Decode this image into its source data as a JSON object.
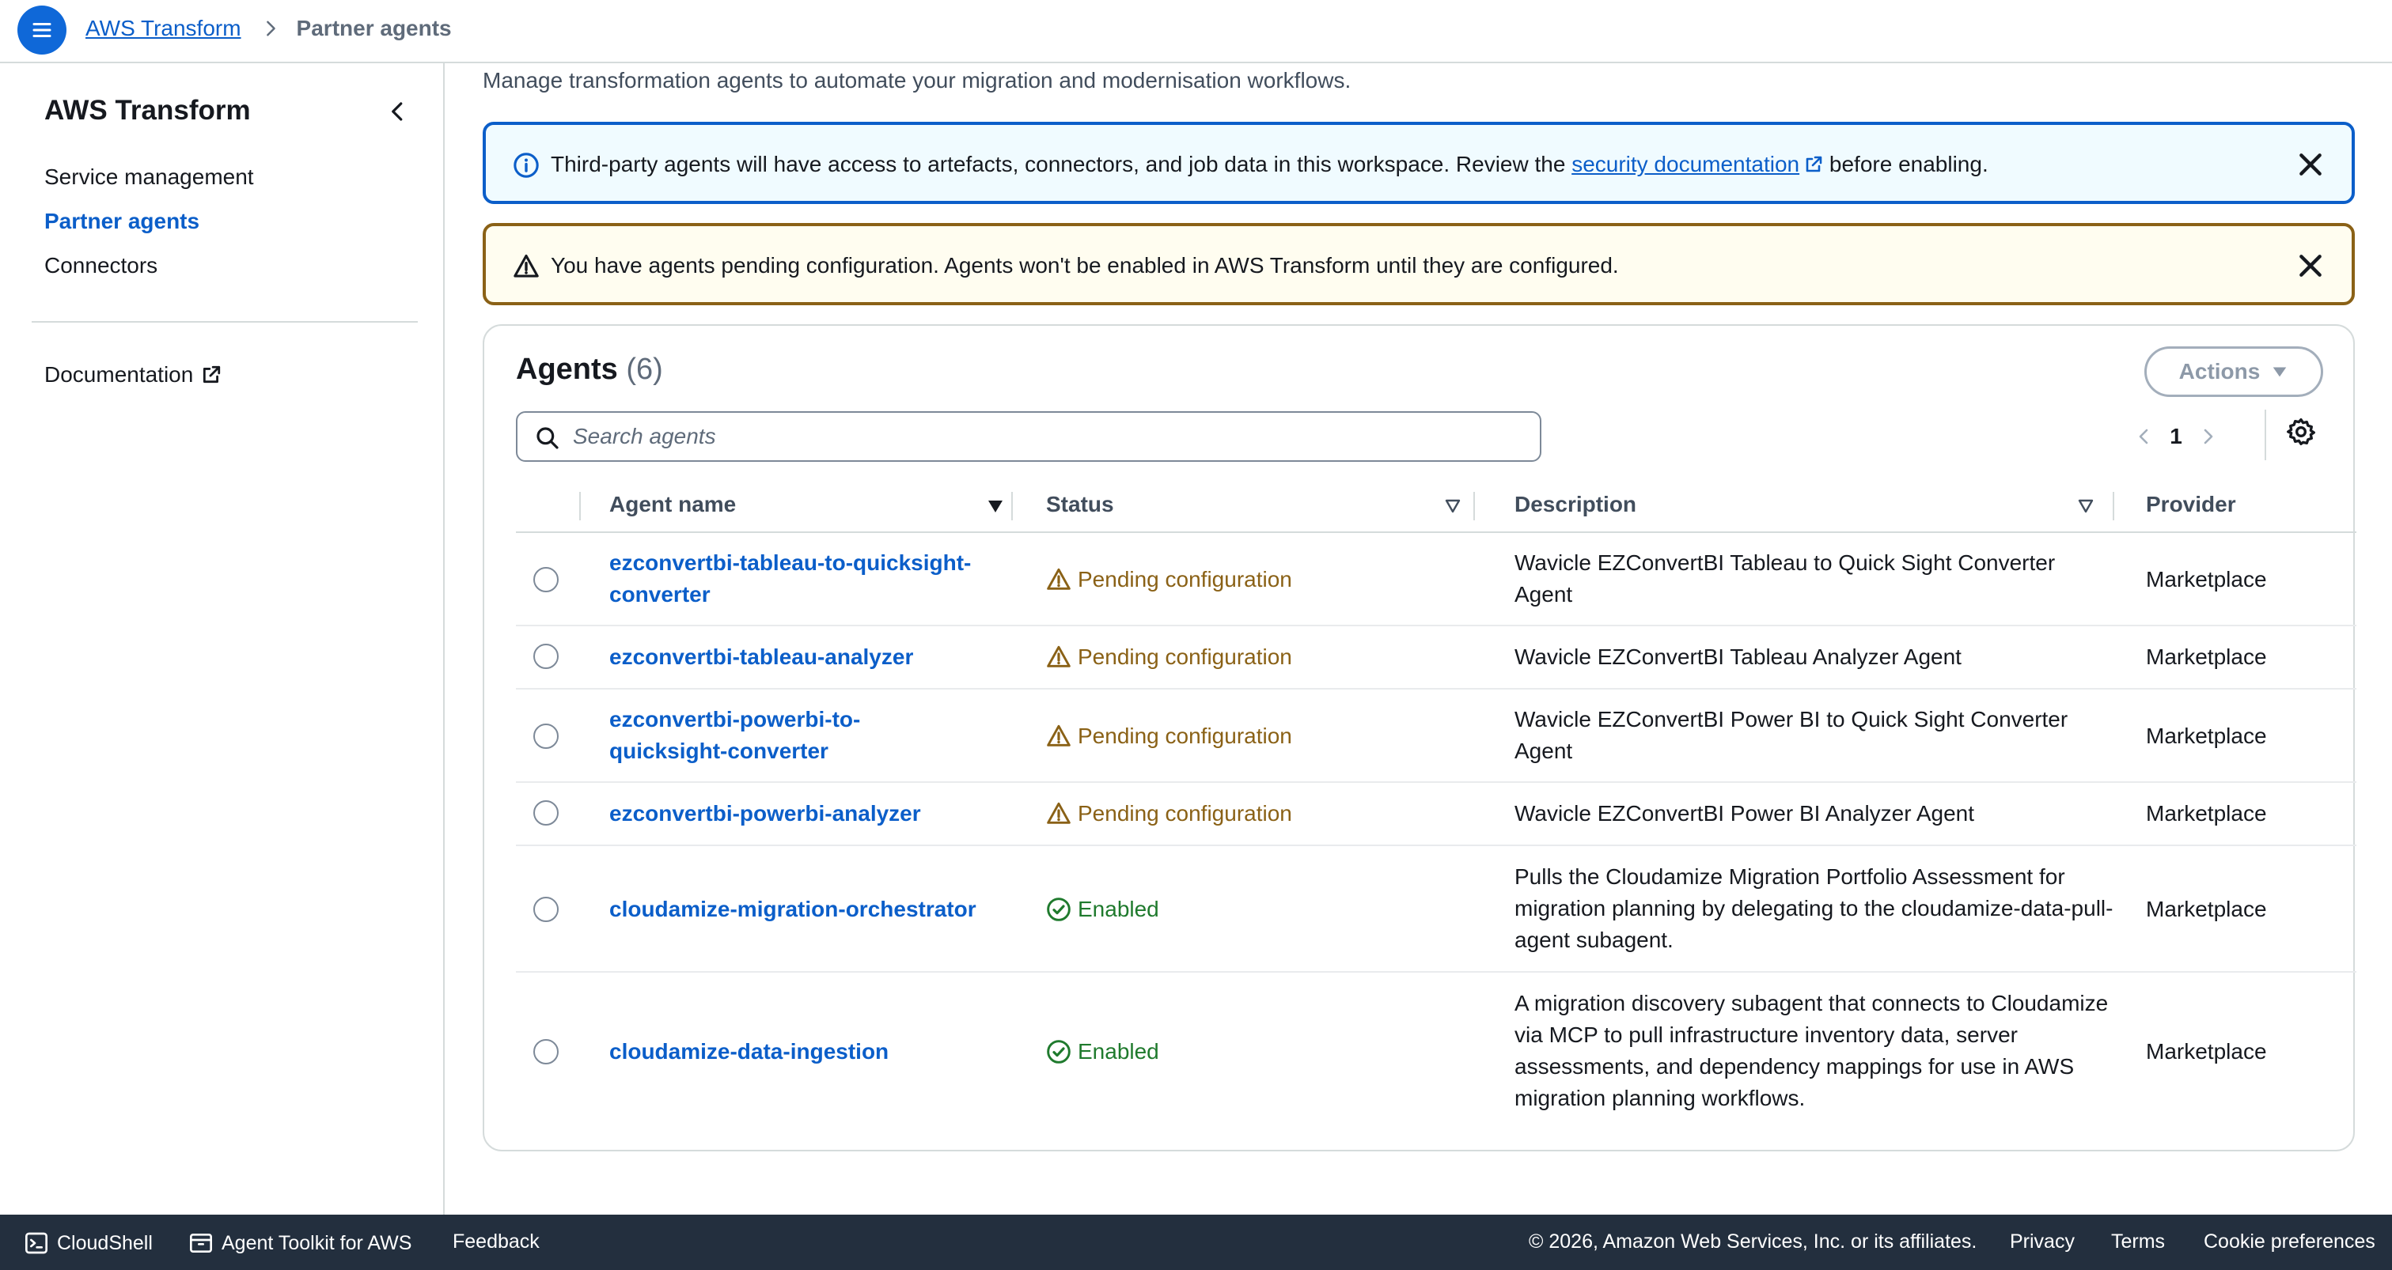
{
  "breadcrumb": {
    "root": "AWS Transform",
    "current": "Partner agents"
  },
  "sidenav": {
    "title": "AWS Transform",
    "items": [
      {
        "label": "Service management"
      },
      {
        "label": "Partner agents"
      },
      {
        "label": "Connectors"
      }
    ],
    "documentation": "Documentation"
  },
  "subtitle": "Manage transformation agents to automate your migration and modernisation workflows.",
  "alerts": {
    "info": {
      "text_before": "Third-party agents will have access to artefacts, connectors, and job data in this workspace. Review the ",
      "link": "security documentation",
      "text_after": " before enabling."
    },
    "warning": {
      "text": "You have agents pending configuration. Agents won't be enabled in AWS Transform until they are configured."
    }
  },
  "panel": {
    "title": "Agents",
    "count": "(6)",
    "actions_label": "Actions",
    "search_placeholder": "Search agents",
    "page": "1"
  },
  "columns": {
    "name": "Agent name",
    "status": "Status",
    "description": "Description",
    "provider": "Provider"
  },
  "rows": [
    {
      "name": "ezconvertbi-tableau-to-quicksight-converter",
      "status": "Pending configuration",
      "description": "Wavicle EZConvertBI Tableau to Quick Sight Converter Agent",
      "provider": "Marketplace"
    },
    {
      "name": "ezconvertbi-tableau-analyzer",
      "status": "Pending configuration",
      "description": "Wavicle EZConvertBI Tableau Analyzer Agent",
      "provider": "Marketplace"
    },
    {
      "name": "ezconvertbi-powerbi-to-quicksight-converter",
      "status": "Pending configuration",
      "description": "Wavicle EZConvertBI Power BI to Quick Sight Converter Agent",
      "provider": "Marketplace"
    },
    {
      "name": "ezconvertbi-powerbi-analyzer",
      "status": "Pending configuration",
      "description": "Wavicle EZConvertBI Power BI Analyzer Agent",
      "provider": "Marketplace"
    },
    {
      "name": "cloudamize-migration-orchestrator",
      "status": "Enabled",
      "description": "Pulls the Cloudamize Migration Portfolio Assessment for migration planning by delegating to the cloudamize-data-pull-agent subagent.",
      "provider": "Marketplace"
    },
    {
      "name": "cloudamize-data-ingestion",
      "status": "Enabled",
      "description": "A migration discovery subagent that connects to Cloudamize via MCP to pull infrastructure inventory data, server assessments, and dependency mappings for use in AWS migration planning workflows.",
      "provider": "Marketplace"
    }
  ],
  "footer": {
    "cloudshell": "CloudShell",
    "toolkit": "Agent Toolkit for AWS",
    "feedback": "Feedback",
    "copyright": "© 2026, Amazon Web Services, Inc. or its affiliates.",
    "privacy": "Privacy",
    "terms": "Terms",
    "cookies": "Cookie preferences"
  },
  "colors": {
    "link": "#0b5ec9",
    "pending": "#8a6116",
    "enabled": "#1f7a2d",
    "footer_bg": "#232f3e"
  }
}
